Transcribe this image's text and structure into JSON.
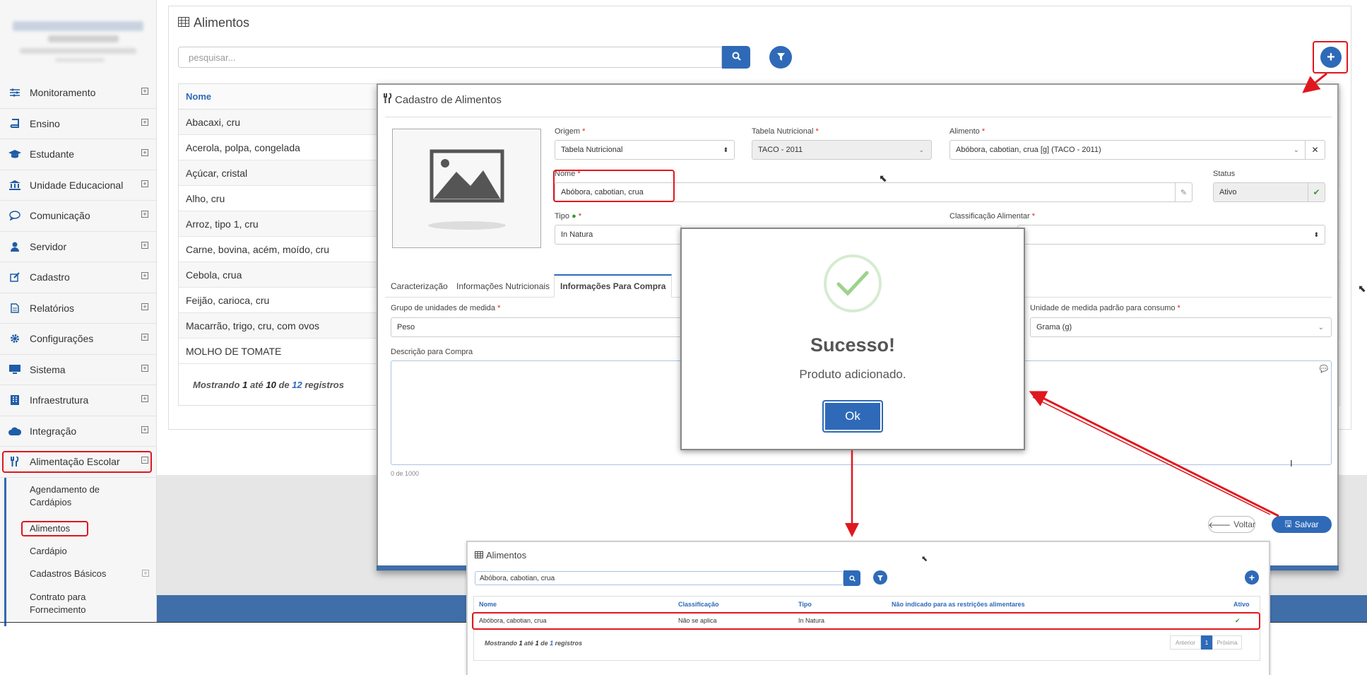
{
  "sidebar": {
    "items": [
      {
        "label": "Monitoramento",
        "icon": "sliders-icon"
      },
      {
        "label": "Ensino",
        "icon": "book-icon"
      },
      {
        "label": "Estudante",
        "icon": "graduation-cap-icon"
      },
      {
        "label": "Unidade Educacional",
        "icon": "institution-icon"
      },
      {
        "label": "Comunicação",
        "icon": "chat-bubble-icon"
      },
      {
        "label": "Servidor",
        "icon": "user-icon"
      },
      {
        "label": "Cadastro",
        "icon": "edit-icon"
      },
      {
        "label": "Relatórios",
        "icon": "file-icon"
      },
      {
        "label": "Configurações",
        "icon": "gear-icon"
      },
      {
        "label": "Sistema",
        "icon": "monitor-icon"
      },
      {
        "label": "Infraestrutura",
        "icon": "building-icon"
      },
      {
        "label": "Integração",
        "icon": "cloud-icon"
      },
      {
        "label": "Alimentação Escolar",
        "icon": "cutlery-icon"
      }
    ],
    "subitems": [
      {
        "label": "Agendamento de Cardápios"
      },
      {
        "label": "Alimentos"
      },
      {
        "label": "Cardápio"
      },
      {
        "label": "Cadastros Básicos"
      },
      {
        "label": "Contrato para Fornecimento"
      }
    ]
  },
  "main": {
    "title": "Alimentos",
    "search_placeholder": "pesquisar...",
    "col_nome": "Nome",
    "rows": [
      "Abacaxi, cru",
      "Acerola, polpa, congelada",
      "Açúcar, cristal",
      "Alho, cru",
      "Arroz, tipo 1, cru",
      "Carne, bovina, acém, moído, cru",
      "Cebola, crua",
      "Feijão, carioca, cru",
      "Macarrão, trigo, cru, com ovos",
      "MOLHO DE TOMATE"
    ],
    "footer": {
      "mostrando": "Mostrando",
      "de_num": "1",
      "ate": "até",
      "ate_num": "10",
      "de": "de",
      "total": "12",
      "registros": "registros"
    }
  },
  "modal": {
    "title": "Cadastro de Alimentos",
    "origem_label": "Origem",
    "origem_value": "Tabela Nutricional",
    "tabela_label": "Tabela Nutricional",
    "tabela_value": "TACO - 2011",
    "alimento_label": "Alimento",
    "alimento_value": "Abóbora, cabotian, crua [g] (TACO - 2011)",
    "nome_label": "Nome",
    "nome_value": "Abóbora, cabotian, crua",
    "status_label": "Status",
    "status_value": "Ativo",
    "tipo_label": "Tipo",
    "tipo_value": "In Natura",
    "classificacao_label": "Classificação Alimentar",
    "tabs": [
      "Caracterização",
      "Informações Nutricionais",
      "Informações Para Compra"
    ],
    "grupo_label": "Grupo de unidades de medida",
    "grupo_value": "Peso",
    "unidade_label": "Unidade de medida padrão para consumo",
    "unidade_value": "Grama (g)",
    "descricao_label": "Descrição para Compra",
    "char_count": "0 de 1000",
    "voltar": "Voltar",
    "salvar": "Salvar"
  },
  "dialog": {
    "title": "Sucesso!",
    "message": "Produto adicionado.",
    "ok": "Ok"
  },
  "inset": {
    "title": "Alimentos",
    "search_value": "Abóbora, cabotian, crua",
    "headers": [
      "Nome",
      "Classificação",
      "Tipo",
      "Não indicado para as restrições alimentares",
      "Ativo"
    ],
    "row": {
      "nome": "Abóbora, cabotian, crua",
      "classificacao": "Não se aplica",
      "tipo": "In Natura",
      "ativo": "✔"
    },
    "footer": {
      "mostrando": "Mostrando",
      "de_num": "1",
      "ate": "até",
      "ate_num": "1",
      "de": "de",
      "total": "1",
      "registros": "registros"
    },
    "pagination": {
      "prev": "Anterior",
      "page": "1",
      "next": "Próxima"
    }
  },
  "colors": {
    "primary": "#2f6ab8",
    "highlight": "#e0171e",
    "success": "#5cb85c"
  }
}
